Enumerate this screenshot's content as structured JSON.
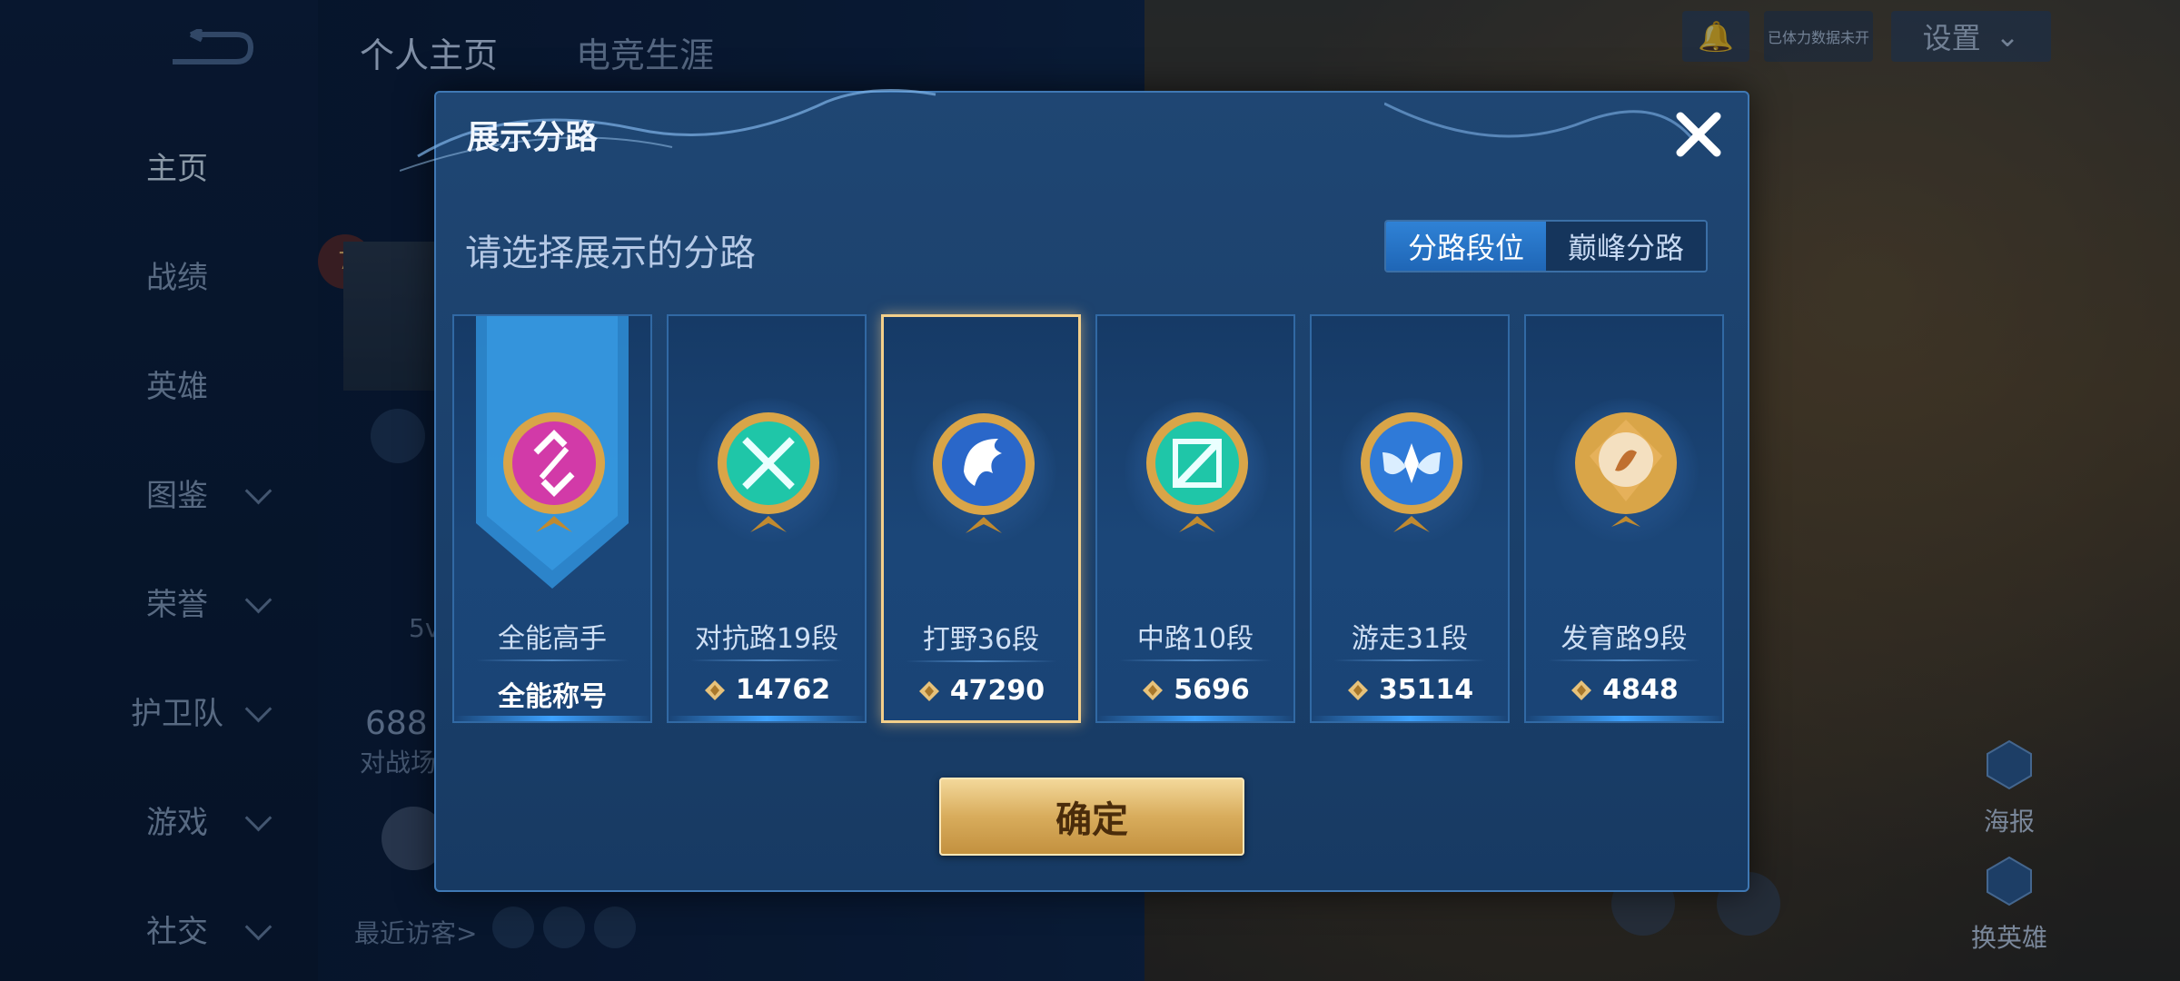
{
  "background": {
    "top_tabs": [
      "个人主页",
      "电竞生涯"
    ],
    "sidebar": [
      {
        "label": "主页",
        "chevron": false,
        "active": true
      },
      {
        "label": "战绩",
        "chevron": false
      },
      {
        "label": "英雄",
        "chevron": false
      },
      {
        "label": "图鉴",
        "chevron": true
      },
      {
        "label": "荣誉",
        "chevron": true
      },
      {
        "label": "护卫队",
        "chevron": true
      },
      {
        "label": "游戏",
        "chevron": true
      },
      {
        "label": "社交",
        "chevron": true
      }
    ],
    "settings_label": "设置",
    "notice_label": "已体力数据未开",
    "level_badge": "7",
    "partial_text_1": "5v",
    "partial_number": "688",
    "partial_text_2": "对战场",
    "recent_visitors": "最近访客>",
    "right_actions": [
      "海报",
      "换英雄"
    ]
  },
  "modal": {
    "title": "展示分路",
    "subtitle": "请选择展示的分路",
    "segments": [
      {
        "label": "分路段位",
        "active": true
      },
      {
        "label": "巅峰分路",
        "active": false
      }
    ],
    "cards": [
      {
        "name": "全能高手",
        "value": "全能称号",
        "gem": false,
        "emblem": "all-round",
        "color": "#d23aa8",
        "selected": false
      },
      {
        "name": "对抗路19段",
        "value": "14762",
        "gem": true,
        "emblem": "clash-lane",
        "color": "#1fc6a8",
        "selected": false
      },
      {
        "name": "打野36段",
        "value": "47290",
        "gem": true,
        "emblem": "jungle",
        "color": "#2a67c9",
        "selected": true
      },
      {
        "name": "中路10段",
        "value": "5696",
        "gem": true,
        "emblem": "mid-lane",
        "color": "#1fc6a8",
        "selected": false
      },
      {
        "name": "游走31段",
        "value": "35114",
        "gem": true,
        "emblem": "roam",
        "color": "#2f7ad8",
        "selected": false
      },
      {
        "name": "发育路9段",
        "value": "4848",
        "gem": true,
        "emblem": "farm-lane",
        "color": "#e0a040",
        "selected": false
      }
    ],
    "confirm_label": "确定"
  }
}
